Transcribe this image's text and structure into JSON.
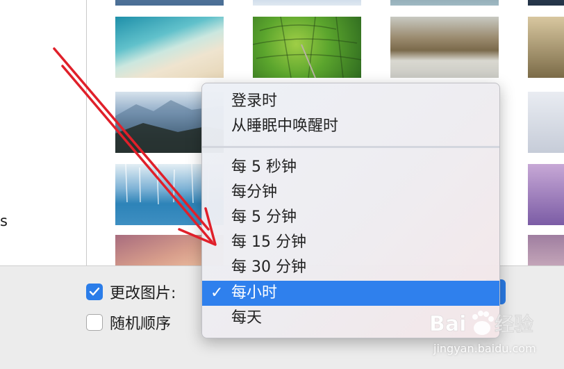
{
  "sidebar": {
    "partial_label": "s"
  },
  "wallpapers": [
    {
      "name": "top-left-partial"
    },
    {
      "name": "top-middle-partial"
    },
    {
      "name": "top-right-partial"
    },
    {
      "name": "top-far-right-partial"
    },
    {
      "name": "beach"
    },
    {
      "name": "green-fields"
    },
    {
      "name": "misty-forest"
    },
    {
      "name": "sunlit-forest-partial"
    },
    {
      "name": "blue-mountains"
    },
    {
      "name": "clouds-partial"
    },
    {
      "name": "frozen-lake-trees"
    },
    {
      "name": "purple-mountains-partial"
    },
    {
      "name": "sand-dunes"
    },
    {
      "name": "sunset-partial"
    }
  ],
  "menu": {
    "items_top": [
      "登录时",
      "从睡眠中唤醒时"
    ],
    "items_bottom": [
      "每 5 秒钟",
      "每分钟",
      "每 5 分钟",
      "每 15 分钟",
      "每 30 分钟",
      "每小时",
      "每天"
    ],
    "selected": "每小时",
    "check_glyph": "✓"
  },
  "options": {
    "change_picture_label": "更改图片:",
    "change_picture_checked": true,
    "random_order_label": "随机顺序",
    "random_order_checked": false
  },
  "watermark": {
    "logo_text": "Baidu 经验",
    "url": "jingyan.baidu.com"
  },
  "colors": {
    "accent": "#2f80ed",
    "annotation_arrow": "#e0202a"
  }
}
